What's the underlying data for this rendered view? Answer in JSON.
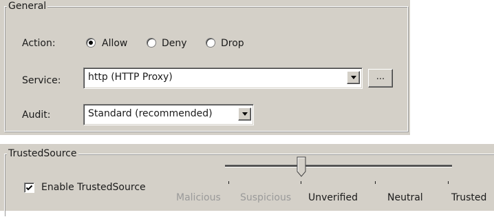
{
  "general": {
    "legend": "General",
    "action": {
      "label": "Action:",
      "options": [
        {
          "label": "Allow",
          "selected": true
        },
        {
          "label": "Deny",
          "selected": false
        },
        {
          "label": "Drop",
          "selected": false
        }
      ]
    },
    "service": {
      "label": "Service:",
      "value": "http (HTTP Proxy)",
      "browse_label": "..."
    },
    "audit": {
      "label": "Audit:",
      "value": "Standard (recommended)"
    }
  },
  "trusted_source": {
    "legend": "TrustedSource",
    "enable_label": "Enable TrustedSource",
    "enabled": true,
    "slider": {
      "levels": [
        "Malicious",
        "Suspicious",
        "Unverified",
        "Neutral",
        "Trusted"
      ],
      "selected_level": "Unverified"
    }
  },
  "colors": {
    "panel_bg": "#d4d0c8",
    "disabled_text": "#9a9a9a"
  },
  "icons": {
    "dropdown": "chevron-down-icon",
    "checkmark": "checkmark-icon",
    "radio_dot": "radio-dot-icon"
  }
}
